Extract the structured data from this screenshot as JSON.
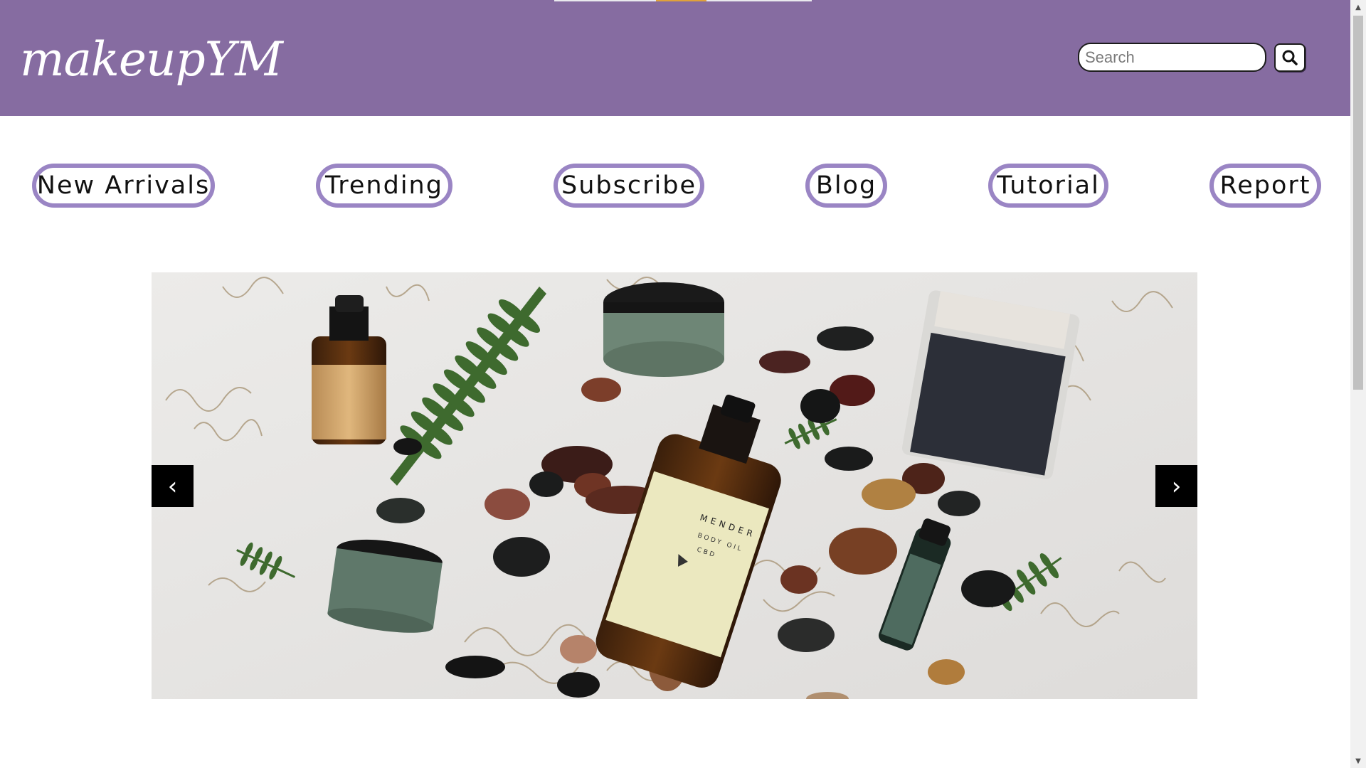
{
  "header": {
    "logo_text": "makeupYM",
    "search": {
      "placeholder": "Search",
      "value": ""
    },
    "search_button_icon": "search-icon",
    "background_color": "#866ca1"
  },
  "nav": {
    "items": [
      {
        "label": "New Arrivals"
      },
      {
        "label": "Trending"
      },
      {
        "label": "Subscribe"
      },
      {
        "label": "Blog"
      },
      {
        "label": "Tutorial"
      },
      {
        "label": "Report"
      }
    ],
    "border_color": "#9a85c4"
  },
  "carousel": {
    "image_description": "flat lay of skincare products with stones and greenery",
    "product_label_main": "MENDER",
    "product_label_sub": "BODY OIL",
    "product_label_cbd": "CBD",
    "prev_glyph": "‹",
    "next_glyph": "›"
  }
}
